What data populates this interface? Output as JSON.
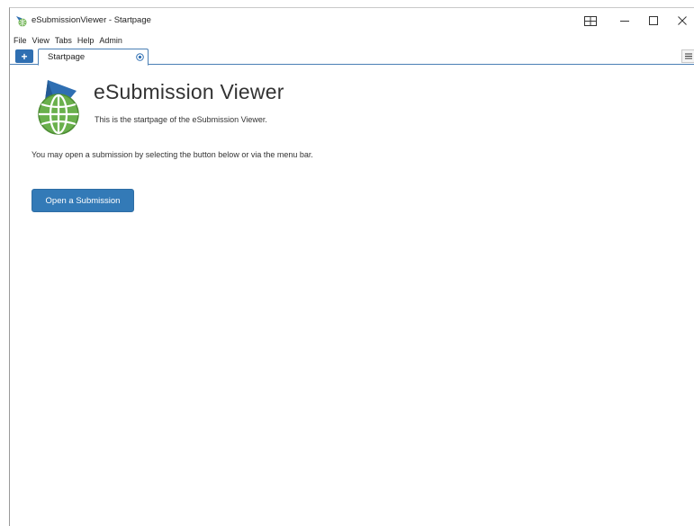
{
  "window": {
    "title": "eSubmissionViewer - Startpage"
  },
  "menu": {
    "items": [
      "File",
      "View",
      "Tabs",
      "Help",
      "Admin"
    ]
  },
  "tabs": {
    "add_label": "+",
    "items": [
      {
        "label": "Startpage",
        "active": true
      }
    ]
  },
  "icons": {
    "app": "app-logo-icon",
    "layout": "window-layout-icon",
    "minimize": "minimize-icon",
    "maximize": "maximize-icon",
    "close": "close-icon",
    "tab_close": "tab-close-icon",
    "tab_list": "hamburger-menu-icon"
  },
  "content": {
    "heading": "eSubmission Viewer",
    "subheading": "This is the startpage of the eSubmission Viewer.",
    "instructions": "You may open a submission by selecting the button below or via the menu bar.",
    "open_button": "Open a Submission"
  },
  "colors": {
    "accent": "#337ab7",
    "logo_green": "#6ab04c",
    "logo_blue": "#2f6fb2"
  }
}
